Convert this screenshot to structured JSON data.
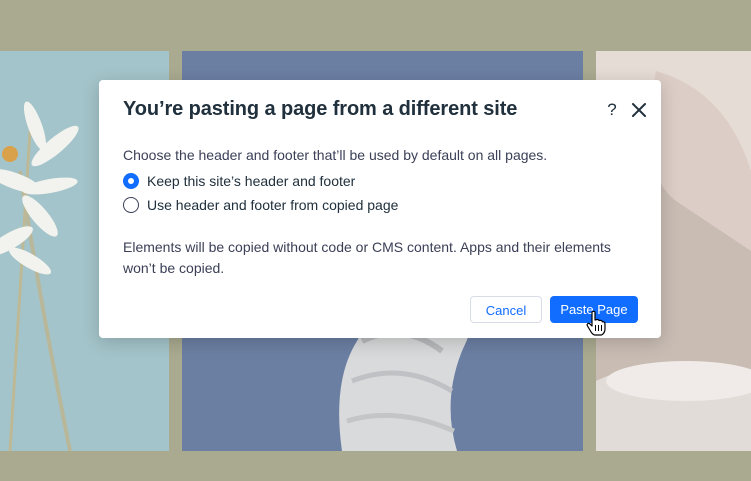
{
  "dialog": {
    "title": "You’re pasting a page from a different site",
    "help_label": "?",
    "subtitle": "Choose the header and footer that’ll be used by default on all pages.",
    "options": [
      {
        "label": "Keep this site’s header and footer",
        "selected": true
      },
      {
        "label": "Use header and footer from copied page",
        "selected": false
      }
    ],
    "notice": "Elements will be copied without code or CMS content. Apps and their elements won’t be copied.",
    "cancel_label": "Cancel",
    "paste_label": "Paste Page"
  },
  "icons": {
    "help": "question-mark-icon",
    "close": "close-icon",
    "cursor": "hand-pointer-icon"
  },
  "colors": {
    "accent": "#116dff",
    "backdrop": "#a9aa90"
  }
}
